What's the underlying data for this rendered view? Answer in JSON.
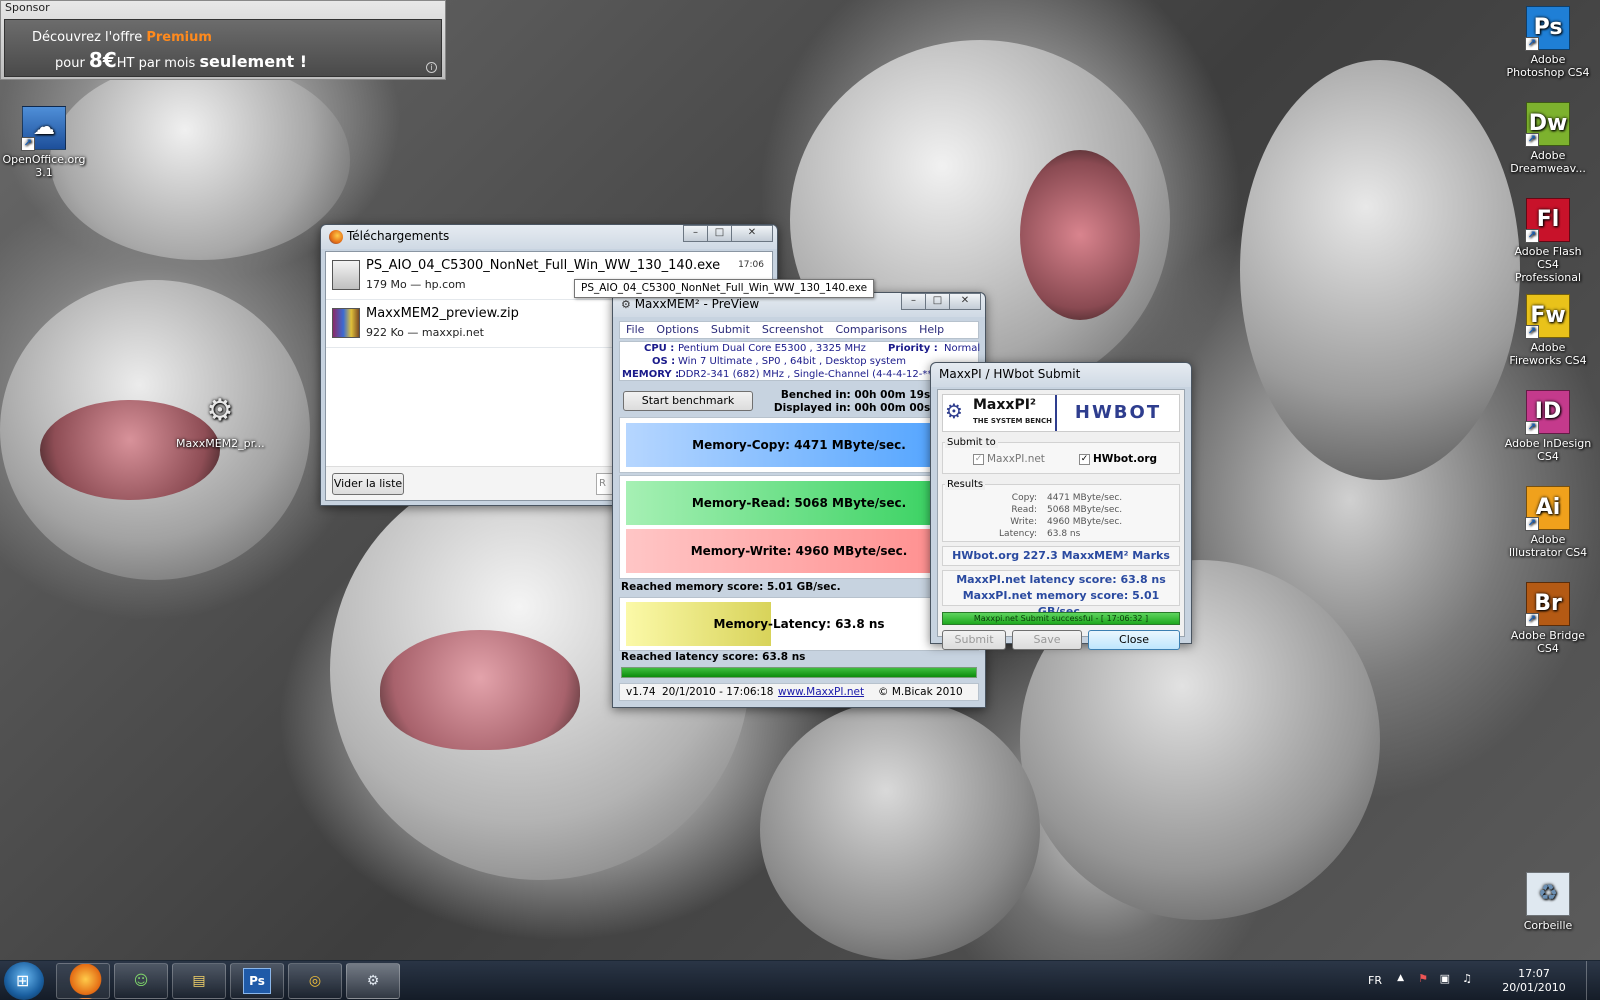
{
  "sponsor": {
    "label": "Sponsor",
    "line1_pre": "Découvrez l'offre ",
    "line1_highlight": "Premium",
    "line2_pre": "pour ",
    "line2_price": "8€",
    "line2_mid": "HT par mois ",
    "line2_bold": "seulement !",
    "info_icon": "info-icon"
  },
  "desktop_icons_left": [
    {
      "label": "OpenOffice.org 3.1",
      "icon": "openoffice-icon"
    },
    {
      "label": "MaxxMEM2_pr...",
      "icon": "gears-icon"
    }
  ],
  "desktop_icons_right": [
    {
      "label": "Adobe Photoshop CS4",
      "abbr": "Ps",
      "color": "#1f7fd6"
    },
    {
      "label": "Adobe Dreamweav...",
      "abbr": "Dw",
      "color": "#7db22e"
    },
    {
      "label": "Adobe Flash CS4 Professional",
      "abbr": "Fl",
      "color": "#c8122a"
    },
    {
      "label": "Adobe Fireworks CS4",
      "abbr": "Fw",
      "color": "#e9c21a"
    },
    {
      "label": "Adobe InDesign CS4",
      "abbr": "ID",
      "color": "#c43a8c"
    },
    {
      "label": "Adobe Illustrator CS4",
      "abbr": "Ai",
      "color": "#f0a11c"
    },
    {
      "label": "Adobe Bridge CS4",
      "abbr": "Br",
      "color": "#b45a14"
    },
    {
      "label": "Corbeille",
      "abbr": "",
      "color": "#dfe8f0"
    }
  ],
  "downloads": {
    "title": "Téléchargements",
    "items": [
      {
        "name": "PS_AIO_04_C5300_NonNet_Full_Win_WW_130_140.exe",
        "meta": "179 Mo — hp.com",
        "time": "17:06"
      },
      {
        "name": "MaxxMEM2_preview.zip",
        "meta": "922 Ko — maxxpi.net",
        "time": ""
      }
    ],
    "clear_button": "Vider la liste",
    "search_placeholder": "R"
  },
  "tooltip": "PS_AIO_04_C5300_NonNet_Full_Win_WW_130_140.exe",
  "maxxmem": {
    "title": "MaxxMEM² - PreView",
    "menu": [
      "File",
      "Options",
      "Submit",
      "Screenshot",
      "Comparisons",
      "Help"
    ],
    "cpu_label": "CPU :",
    "cpu_value": "Pentium Dual Core E5300 , 3325 MHz",
    "os_label": "OS :",
    "os_value": "Win 7 Ultimate , SP0 , 64bit , Desktop system",
    "memory_label": "MEMORY :",
    "memory_value": "DDR2-341 (682) MHz , Single-Channel (4-4-4-12-**T)",
    "priority_label": "Priority :",
    "priority_value": "Normal",
    "start_button": "Start benchmark",
    "benched_in": "Benched in: 00h 00m 19s 948ms",
    "displayed_in": "Displayed in: 00h 00m 00s 032ms",
    "copy_label": "Memory-Copy: 4471 MByte/sec.",
    "read_label": "Memory-Read: 5068 MByte/sec.",
    "write_label": "Memory-Write: 4960 MByte/sec.",
    "memory_score": "Reached memory score: 5.01 GB/sec.",
    "latency_label": "Memory-Latency: 63.8 ns",
    "latency_score": "Reached latency score: 63.8 ns",
    "progress": 1.0,
    "copy_fill": 1.0,
    "read_fill": 1.0,
    "write_fill": 1.0,
    "latency_fill": 0.42,
    "status_version": "v1.74",
    "status_date": "20/1/2010 - 17:06:18",
    "status_link": "www.MaxxPI.net",
    "status_author": "© M.Bicak 2010"
  },
  "hwbot": {
    "title": "MaxxPI / HWbot Submit",
    "maxxpi_logo": "MaxxPI²",
    "maxxpi_sub": "THE SYSTEM BENCH",
    "hwbot_logo": "HWBOT",
    "submit_to": "Submit to",
    "opt_maxxpi": "MaxxPI.net",
    "opt_hwbot": "HWbot.org",
    "results": "Results",
    "rows": [
      {
        "k": "Copy:",
        "v": "4471 MByte/sec."
      },
      {
        "k": "Read:",
        "v": "5068 MByte/sec."
      },
      {
        "k": "Write:",
        "v": "4960 MByte/sec."
      },
      {
        "k": "Latency:",
        "v": "63.8 ns"
      }
    ],
    "hwbot_marks": "HWbot.org  227.3  MaxxMEM² Marks",
    "latency_score": "MaxxPI.net latency score:  63.8  ns",
    "memory_score": "MaxxPI.net memory score:  5.01  GB/sec.",
    "status": "Maxxpi.net Submit successful - [ 17:06:32 ]",
    "btn_submit": "Submit",
    "btn_save": "Save",
    "btn_close": "Close"
  },
  "taskbar": {
    "lang": "FR",
    "time": "17:07",
    "date": "20/01/2010",
    "apps": [
      "firefox-icon",
      "messenger-icon",
      "explorer-icon",
      "photoshop-icon",
      "disc-icon",
      "gears-icon"
    ],
    "ps_abbr": "Ps"
  }
}
